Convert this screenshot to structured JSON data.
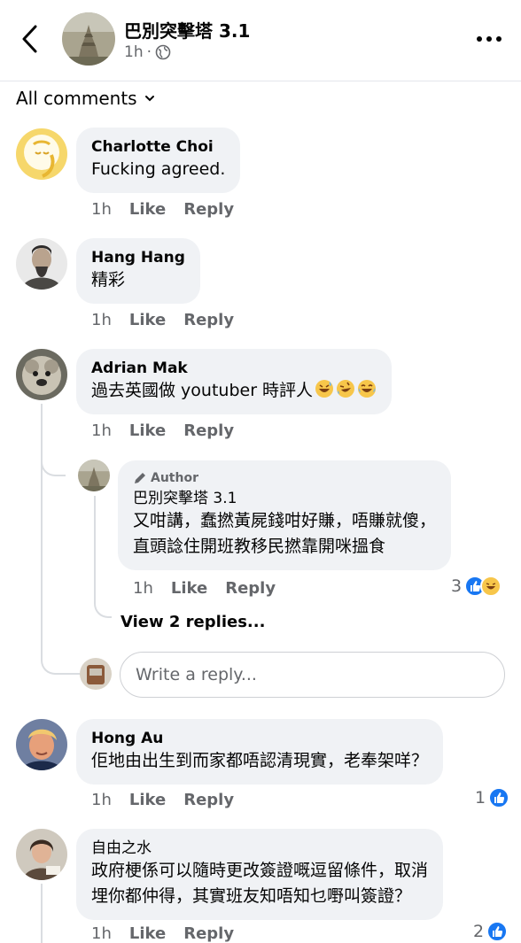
{
  "header": {
    "page_name": "巴別突擊塔 3.1",
    "time": "1h",
    "separator": "·",
    "icons": {
      "back": "chevron-left-icon",
      "privacy": "globe-icon",
      "more": "more-dots-icon"
    }
  },
  "filter": {
    "label": "All comments",
    "icon": "chevron-down-icon"
  },
  "comments": [
    {
      "name": "Charlotte Choi",
      "text": "Fucking agreed.",
      "time": "1h",
      "like": "Like",
      "reply": "Reply"
    },
    {
      "name": "Hang Hang",
      "text": "精彩",
      "time": "1h",
      "like": "Like",
      "reply": "Reply"
    },
    {
      "name": "Adrian Mak",
      "text": "過去英國做 youtuber 時評人",
      "emojis": [
        "grinning-sweat-emoji",
        "rolling-laughing-emoji",
        "tears-of-joy-emoji"
      ],
      "time": "1h",
      "like": "Like",
      "reply": "Reply",
      "replies": [
        {
          "badge": "Author",
          "name": "巴別突擊塔 3.1",
          "text_line1": "又咁講，蠢撚黃屍錢咁好賺，唔賺就傻，",
          "text_line2": "直頭諗住開班教移民撚靠開咪搵食",
          "time": "1h",
          "like": "Like",
          "reply": "Reply",
          "reaction_count": "3",
          "reaction_types": [
            "like",
            "haha"
          ]
        }
      ],
      "view_replies": "View 2 replies...",
      "reply_placeholder": "Write a reply..."
    },
    {
      "name": "Hong Au",
      "text": "佢地由出生到而家都唔認清現實，老奉架咩？",
      "time": "1h",
      "like": "Like",
      "reply": "Reply",
      "reaction_count": "1",
      "reaction_types": [
        "like"
      ]
    },
    {
      "name": "自由之水",
      "text_line1": "政府梗係可以隨時更改簽證嘅逗留條件，取消",
      "text_line2": "埋你都仲得，其實班友知唔知乜嘢叫簽證？",
      "time": "1h",
      "like": "Like",
      "reply": "Reply",
      "reaction_count": "2",
      "reaction_types": [
        "like"
      ]
    }
  ],
  "colors": {
    "bubble": "#f0f2f5",
    "meta": "#65676b",
    "like_blue": "#1877f2",
    "haha_yellow": "#f7c64a",
    "thread": "#dadde1"
  }
}
